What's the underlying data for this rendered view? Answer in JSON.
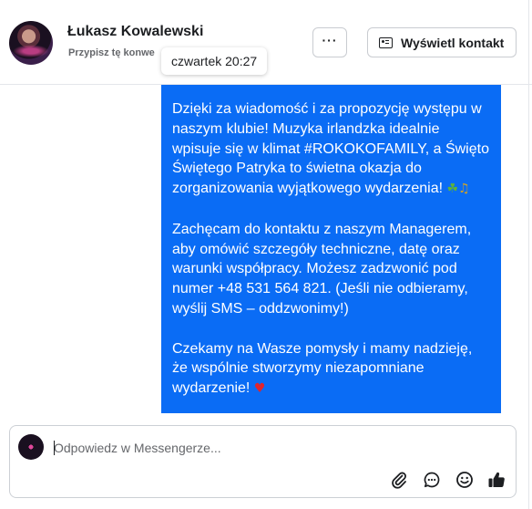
{
  "header": {
    "contact_name": "Łukasz Kowalewski",
    "pin_label": "Przypisz tę konwe",
    "tooltip": "czwartek 20:27",
    "more_label": "···",
    "view_contact_label": "Wyświetl kontakt"
  },
  "message": {
    "paragraph1_text": "Dzięki za wiadomość i za propozycję występu w naszym klubie! Muzyka irlandzka idealnie wpisuje się w klimat #ROKOKOFAMILY, a Święto Świętego Patryka to świetna okazja do zorganizowania wyjątkowego wydarzenia!",
    "paragraph1_emoji1": "☘",
    "paragraph1_emoji2": "♫",
    "paragraph2": "Zachęcam do kontaktu z naszym Managerem, aby omówić szczegóły techniczne, datę oraz warunki współpracy. Możesz zadzwonić pod numer +48 531 564 821. (Jeśli nie odbieramy, wyślij SMS – oddzwonimy!)",
    "paragraph3_text": "Czekamy na Wasze pomysły i mamy nadzieję, że wspólnie stworzymy niezapomniane wydarzenie!",
    "paragraph3_emoji": "♥"
  },
  "composer": {
    "placeholder": "Odpowiedz w Messengerze...",
    "value": ""
  },
  "icons": {
    "avatar": "profile-photo",
    "more": "ellipsis-icon",
    "view_contact": "contact-card-icon",
    "attach": "paperclip-icon",
    "saved_replies": "chat-bubble-icon",
    "emoji": "smiley-icon",
    "like": "thumbs-up-icon"
  },
  "colors": {
    "bubble": "#0a6cf5",
    "text": "#1c1e21",
    "secondary_text": "#65676b"
  }
}
